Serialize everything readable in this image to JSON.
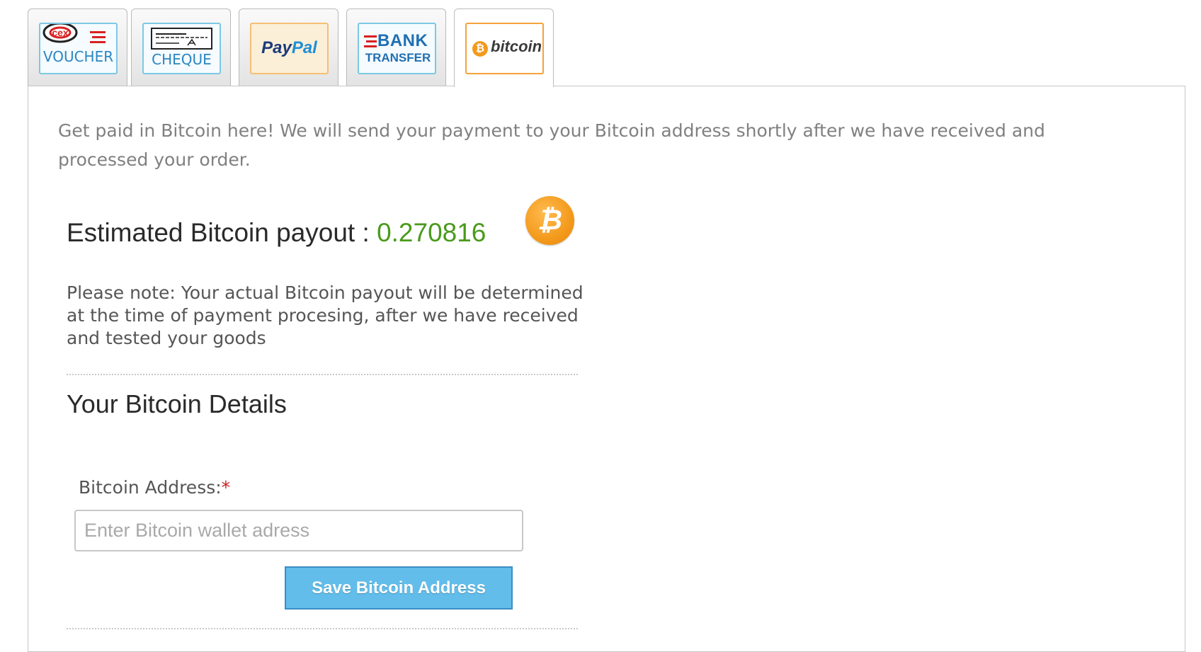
{
  "tabs": [
    {
      "id": "voucher",
      "logo_text": "VOUCHER",
      "brand_mark": "cex",
      "icon": "cex-voucher-logo-icon",
      "active": false
    },
    {
      "id": "cheque",
      "logo_text": "CHEQUE",
      "icon": "cheque-logo-icon",
      "active": false
    },
    {
      "id": "paypal",
      "logo_text_a": "Pay",
      "logo_text_b": "Pal",
      "icon": "paypal-logo-icon",
      "active": false
    },
    {
      "id": "bank",
      "logo_text_a": "BANK",
      "logo_text_b": "TRANSFER",
      "icon": "bank-transfer-logo-icon",
      "active": false
    },
    {
      "id": "bitcoin",
      "logo_text": "bitcoin",
      "icon": "bitcoin-logo-icon",
      "active": true
    }
  ],
  "panel": {
    "intro": "Get paid in Bitcoin here! We will send your payment to your Bitcoin address shortly after we have received and processed your order.",
    "payout_label": "Estimated Bitcoin payout : ",
    "payout_value": "0.270816",
    "payout_icon": "bitcoin-coin-icon",
    "note": "Please note: Your actual Bitcoin payout will be determined at the time of payment procesing, after we have received and tested your goods",
    "section_title": "Your Bitcoin Details",
    "address_label": "Bitcoin Address:",
    "required_mark": "*",
    "address_value": "",
    "address_placeholder": "Enter Bitcoin wallet adress",
    "save_button": "Save Bitcoin Address"
  },
  "colors": {
    "payout_value": "#4a9a1c",
    "button_bg": "#62bdeb",
    "bitcoin_orange": "#f39a1c",
    "required": "#cc2222"
  }
}
